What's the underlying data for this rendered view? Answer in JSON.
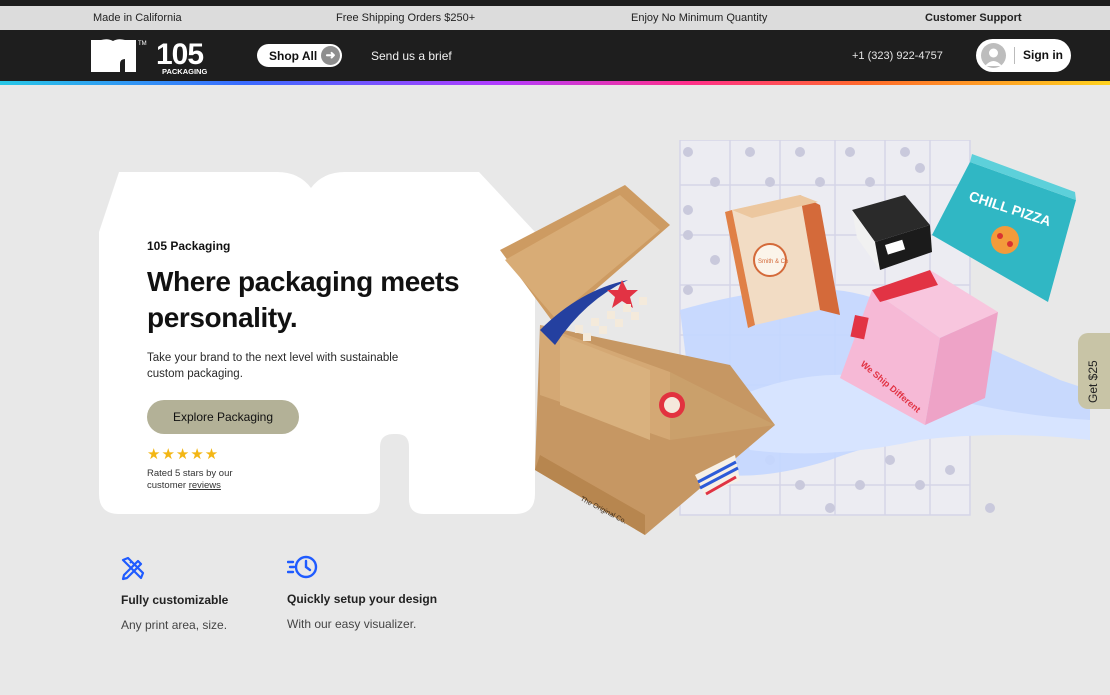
{
  "announcement": {
    "left": "Made in California",
    "shipping": "Free Shipping Orders $250+",
    "minimum": "Enjoy No Minimum Quantity",
    "support": "Customer Support"
  },
  "nav": {
    "logo_number": "105",
    "logo_word": "PACKAGING",
    "logo_tm": "TM",
    "shop_all": "Shop All",
    "brief": "Send us a brief",
    "phone": "+1 (323) 922-4757",
    "sign_in": "Sign in"
  },
  "hero": {
    "eyebrow": "105 Packaging",
    "headline": "Where packaging meets personality.",
    "subtext": "Take your brand to the next level with sustainable custom packaging.",
    "cta": "Explore Packaging",
    "stars": "★★★★★",
    "rated_prefix": "Rated 5 stars by our customer",
    "rated_link": "reviews"
  },
  "art": {
    "chill": "CHILL PIZZA",
    "ship": "We Ship Different",
    "original": "The Original Co.",
    "smith": "Smith & Co"
  },
  "side_tab": "Get $25",
  "features": [
    {
      "title": "Fully customizable",
      "desc": "Any print area, size.",
      "icon": "pencil-ruler-icon"
    },
    {
      "title": "Quickly setup your design",
      "desc": "With our easy visualizer.",
      "icon": "fast-clock-icon"
    }
  ],
  "colors": {
    "nav_bg": "#1e1e1e",
    "cta": "#b3b197",
    "accent_blue": "#1f5bff",
    "stars": "#f3b614",
    "side_tab": "#c8c4a6"
  }
}
